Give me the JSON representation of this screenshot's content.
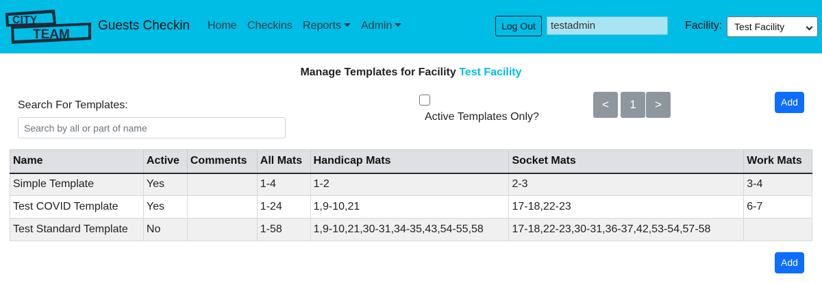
{
  "brand": {
    "logo_line1": "CITY",
    "logo_line2": "TEAM",
    "title": "Guests Checkin"
  },
  "nav": {
    "home": "Home",
    "checkins": "Checkins",
    "reports": "Reports",
    "admin": "Admin"
  },
  "user": {
    "logout_label": "Log Out",
    "username": "testadmin"
  },
  "facility": {
    "label": "Facility:",
    "selected": "Test Facility"
  },
  "page": {
    "heading_prefix": "Manage Templates for Facility",
    "heading_facility": "Test Facility",
    "search_label": "Search For Templates:",
    "search_placeholder": "Search by all or part of name",
    "active_only_label": "Active Templates Only?",
    "active_only_checked": false,
    "pager": {
      "prev": "<",
      "page": "1",
      "next": ">"
    },
    "add_label": "Add"
  },
  "table": {
    "headers": [
      "Name",
      "Active",
      "Comments",
      "All Mats",
      "Handicap Mats",
      "Socket Mats",
      "Work Mats"
    ],
    "rows": [
      [
        "Simple Template",
        "Yes",
        "",
        "1-4",
        "1-2",
        "2-3",
        "3-4"
      ],
      [
        "Test COVID Template",
        "Yes",
        "",
        "1-24",
        "1,9-10,21",
        "17-18,22-23",
        "6-7"
      ],
      [
        "Test Standard Template",
        "No",
        "",
        "1-58",
        "1,9-10,21,30-31,34-35,43,54-55,58",
        "17-18,22-23,30-31,36-37,42,53-54,57-58",
        ""
      ]
    ]
  },
  "colors": {
    "navbar": "#00bde6",
    "accent": "#00bde6",
    "primary_button": "#0d6efd",
    "pager_button": "#8e979e"
  },
  "icons": {
    "nav_dropdown": "caret-down-icon",
    "select_dropdown": "chevron-down-icon"
  }
}
